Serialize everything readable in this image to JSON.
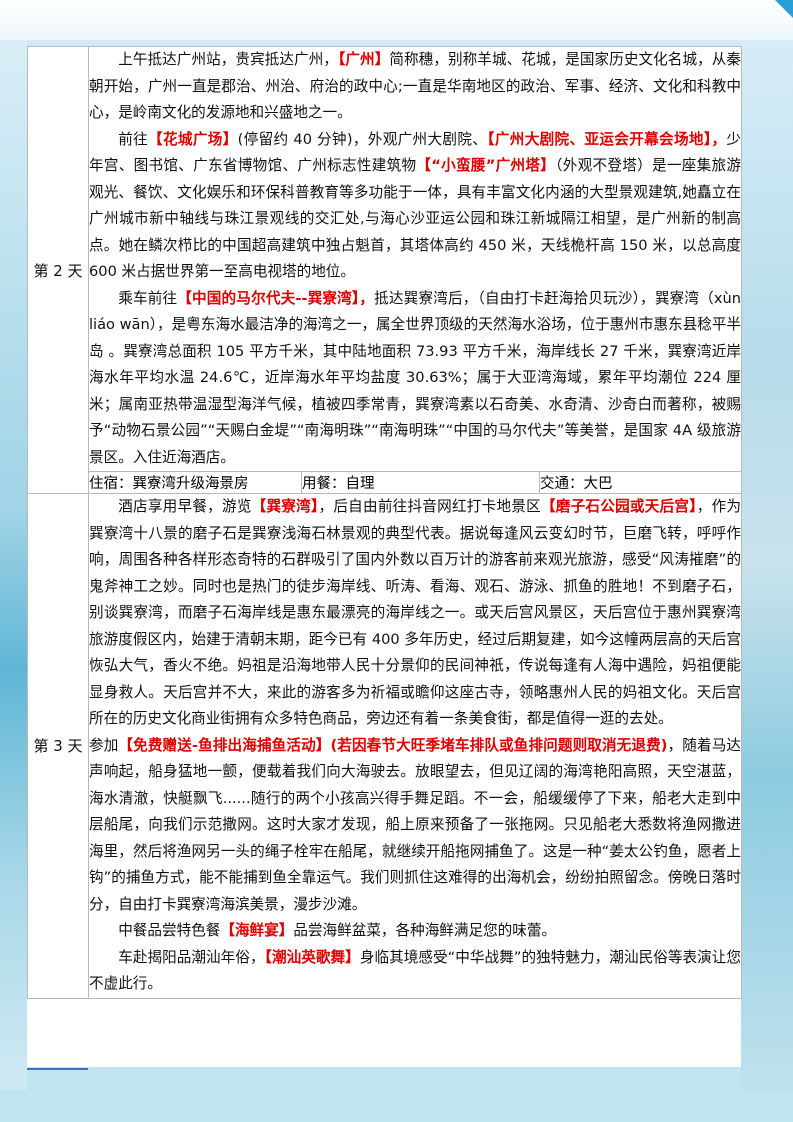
{
  "day2": {
    "label": "第 2 天",
    "p1": {
      "a": "上午抵达广州站，贵宾抵达广州，",
      "b": "【广州】",
      "c": "简称穗，别称羊城、花城，是国家历史文化名城，从秦朝开始，广州一直是郡治、州治、府治的政中心;一直是华南地区的政治、军事、经济、文化和科教中心，是岭南文化的发源地和兴盛地之一。"
    },
    "p2": {
      "a": "前往",
      "b": "【花城广场】",
      "c": "(停留约 40 分钟)，外观广州大剧院、",
      "d": "【广州大剧院、亚运会开幕会场地】，",
      "e": "少年宫、图书馆、广东省博物馆、广州标志性建筑物",
      "f": "【“小蛮腰”广州塔】",
      "g": "（外观不登塔）是一座集旅游观光、餐饮、文化娱乐和环保科普教育等多功能于一体，具有丰富文化内涵的大型景观建筑,她矗立在广州城市新中轴线与珠江景观线的交汇处,与海心沙亚运公园和珠江新城隔江相望，是广州新的制高点。她在鳞次栉比的中国超高建筑中独占魁首，其塔体高约 450 米，天线桅杆高 150 米，以总高度 600 米占据世界第一至高电视塔的地位。"
    },
    "p3": {
      "a": "乘车前往",
      "b": "【中国的马尔代夫--巽寮湾】，",
      "c": "抵达巽寮湾后，（自由打卡赶海拾贝玩沙），巽寮湾（xùn liáo wān），是粤东海水最洁净的海湾之一，属全世界顶级的天然海水浴场，位于惠州市惠东县稔平半岛 。巽寮湾总面积 105 平方千米，其中陆地面积 73.93 平方千米，海岸线长 27 千米，巽寮湾近岸海水年平均水温 24.6℃，近岸海水年平均盐度 30.63%；属于大亚湾海域，累年平均潮位 224 厘米；属南亚热带温湿型海洋气候，植被四季常青，巽寮湾素以石奇美、水奇清、沙奇白而著称，被赐予“动物石景公园”“天赐白金堤”“南海明珠”“南海明珠”“中国的马尔代夫”等美誉，是国家 4A 级旅游景区。入住近海酒店。"
    },
    "info": {
      "stay": "住宿：巽寮湾升级海景房",
      "meal": "用餐：自理",
      "transport": "交通：大巴"
    }
  },
  "day3": {
    "label": "第 3 天",
    "p1": {
      "a": "酒店享用早餐，游览",
      "b": "【巽寮湾】",
      "c": "，后自由前往抖音网红打卡地景区",
      "d": "【磨子石公园或天后宫】",
      "e": "，作为巽寮湾十八景的磨子石是巽寮浅海石林景观的典型代表。据说每逢风云变幻时节，巨磨飞转，呼呼作响，周围各种各样形态奇特的石群吸引了国内外数以百万计的游客前来观光旅游，感受“风涛摧磨”的鬼斧神工之妙。同时也是热门的徒步海岸线、听涛、看海、观石、游泳、抓鱼的胜地！不到磨子石，别谈巽寮湾，而磨子石海岸线是惠东最漂亮的海岸线之一。或天后宫风景区，天后宫位于惠州巽寮湾旅游度假区内，始建于清朝末期，距今已有 400 多年历史，经过后期复建，如今这幢两层高的天后宫恢弘大气，香火不绝。妈祖是沿海地带人民十分景仰的民间神祇，传说每逢有人海中遇险，妈祖便能显身救人。天后宫并不大，来此的游客多为祈福或瞻仰这座古寺，领略惠州人民的妈祖文化。天后宫所在的历史文化商业街拥有众多特色商品，旁边还有着一条美食街，都是值得一逛的去处。"
    },
    "p2": {
      "a": "参加",
      "b": "【免费赠送-鱼排出海捕鱼活动】(若因春节大旺季堵车排队或鱼排问题则取消无退费)",
      "c": "，随着马达声响起，船身猛地一颤，便载着我们向大海驶去。放眼望去，但见辽阔的海湾艳阳高照，天空湛蓝，海水清澈，快艇飘飞......随行的两个小孩高兴得手舞足蹈。不一会，船缓缓停了下来，船老大走到中层船尾，向我们示范撒网。这时大家才发现，船上原来预备了一张拖网。只见船老大悉数将渔网撒进海里，然后将渔网另一头的绳子栓牢在船尾，就继续开船拖网捕鱼了。这是一种“姜太公钓鱼，愿者上钩”的捕鱼方式，能不能捕到鱼全靠运气。我们则抓住这难得的出海机会，纷纷拍照留念。傍晚日落时分，自由打卡巽寮湾海滨美景，漫步沙滩。"
    },
    "p3": {
      "a": "中餐品尝特色餐",
      "b": "【海鲜宴】",
      "c": "品尝海鲜盆菜，各种海鲜满足您的味蕾。"
    },
    "p4": {
      "a": "车赴揭阳品潮汕年俗，",
      "b": "【潮汕英歌舞】",
      "c": "身临其境感受“中华战舞”的独特魅力，潮汕民俗等表演让您不虚此行。"
    }
  }
}
